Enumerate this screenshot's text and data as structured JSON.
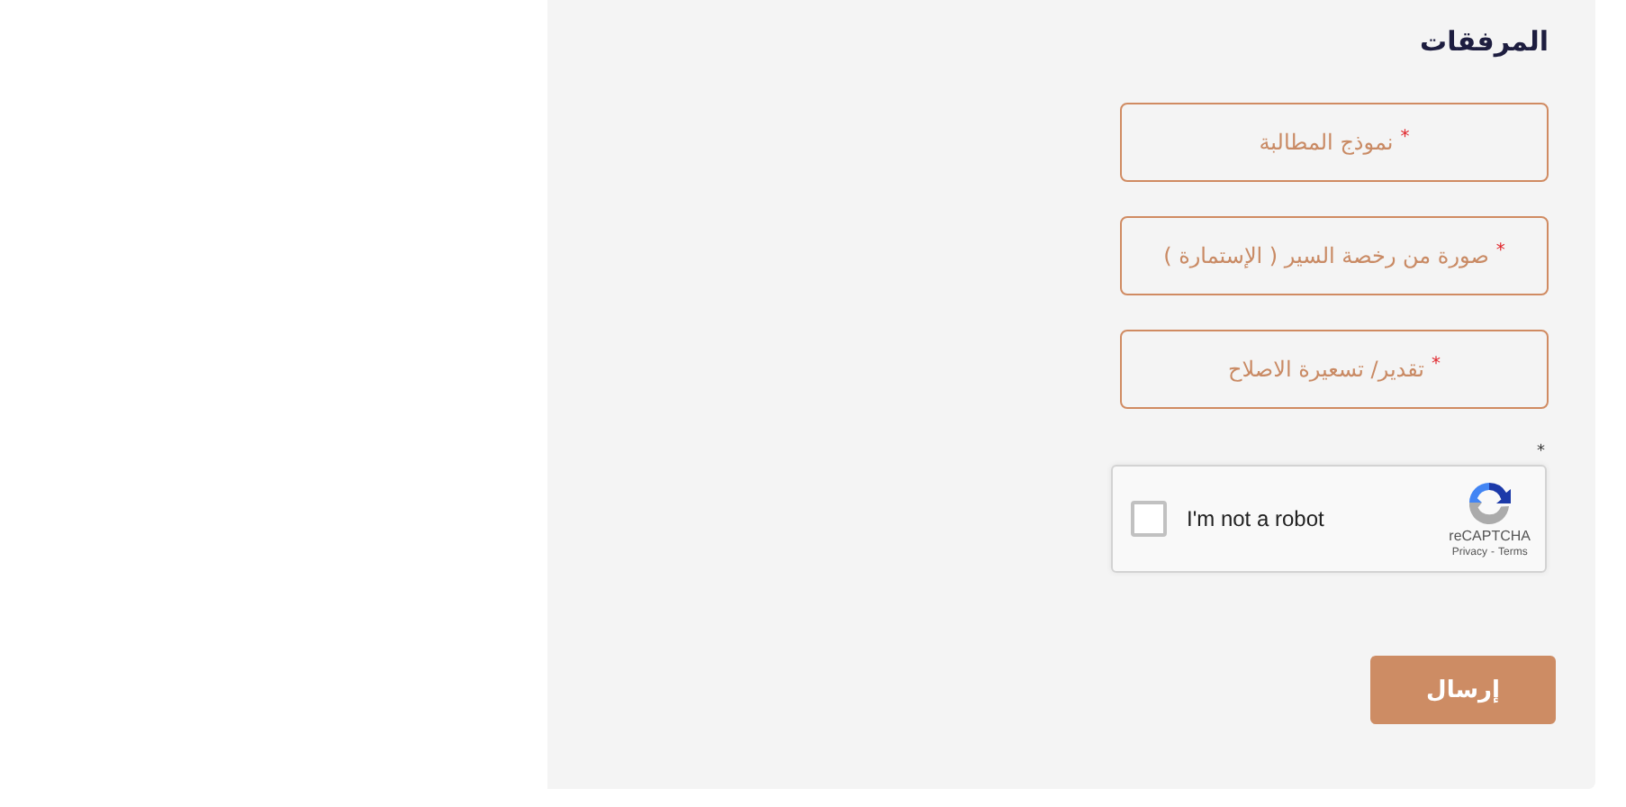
{
  "section": {
    "title": "المرفقات"
  },
  "fields": [
    {
      "label": "نموذج المطالبة",
      "required_mark": "*"
    },
    {
      "label": "صورة من رخصة السير ( الإستمارة )",
      "required_mark": "*"
    },
    {
      "label": "تقدير/ تسعيرة الاصلاح",
      "required_mark": "*"
    }
  ],
  "captcha": {
    "required_mark": "*",
    "label": "I'm not a robot",
    "checked": false,
    "brand": "reCAPTCHA",
    "privacy": "Privacy",
    "separator": "-",
    "terms": "Terms"
  },
  "submit": {
    "label": "إرسال"
  }
}
